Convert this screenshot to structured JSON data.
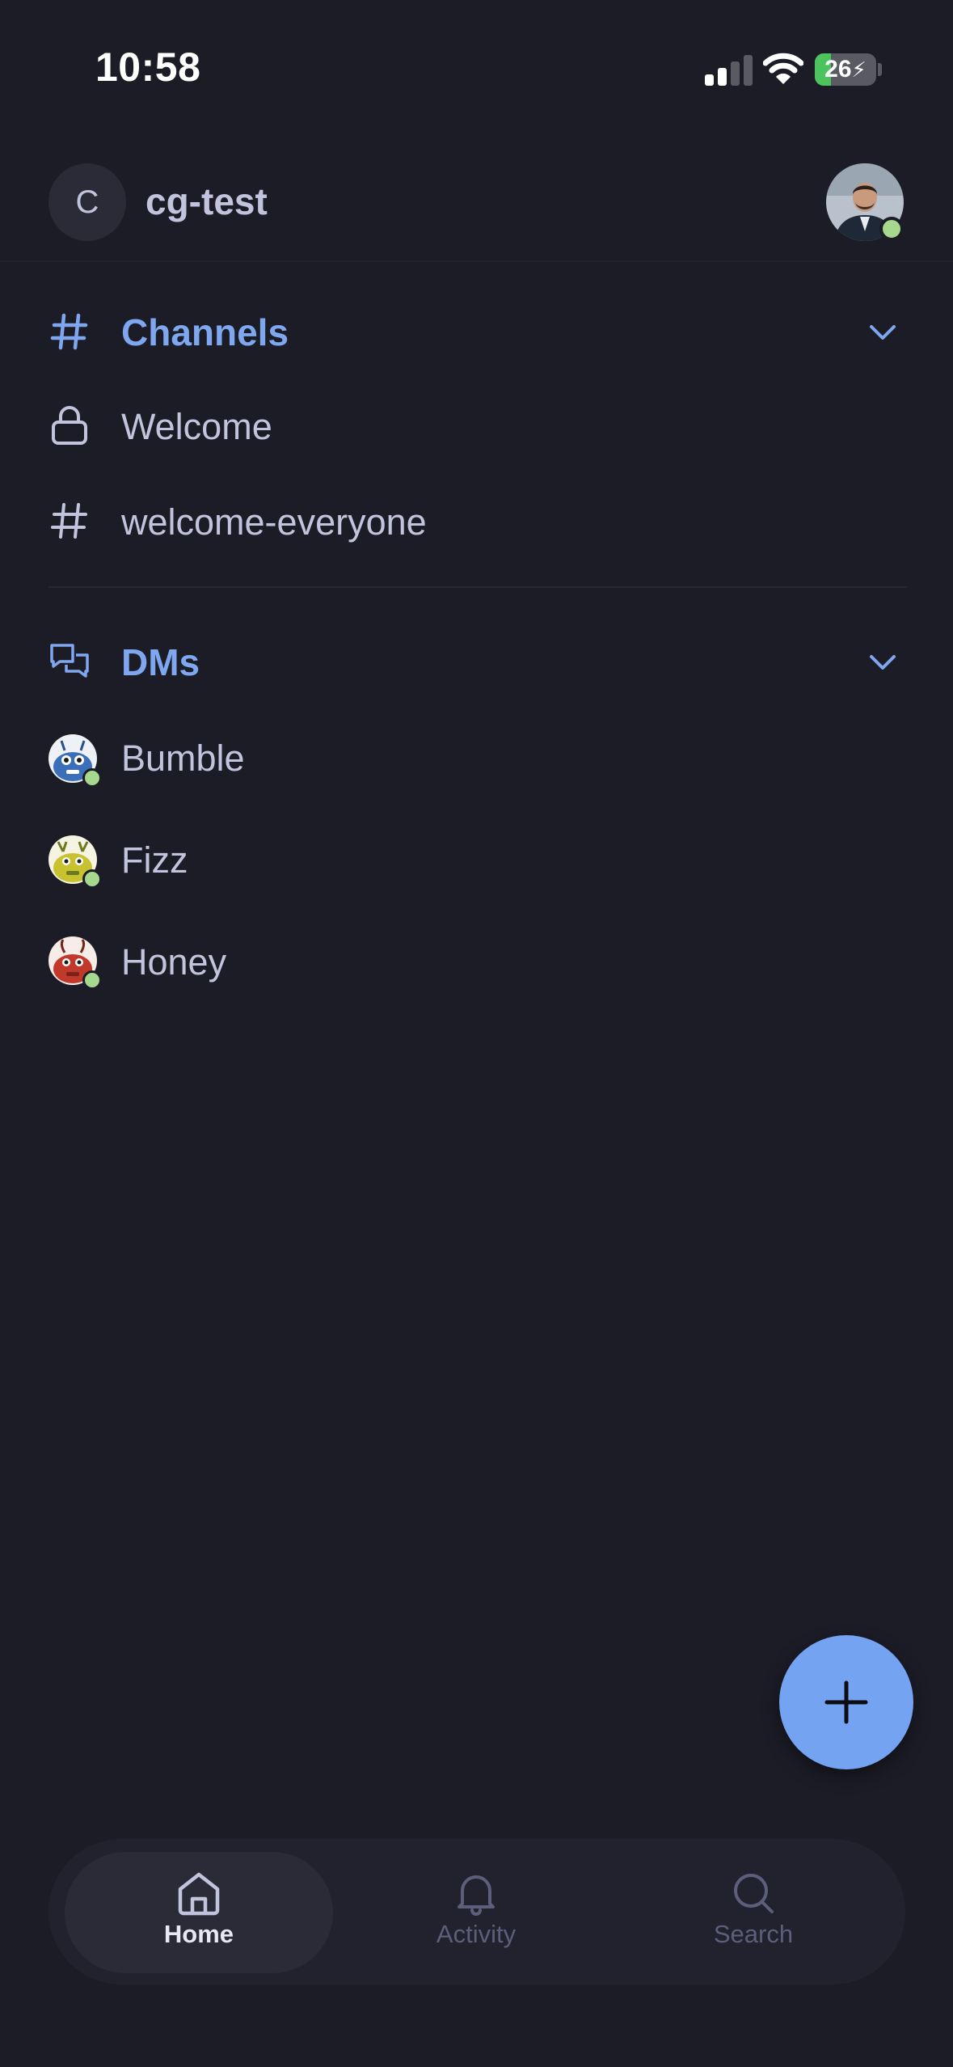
{
  "status_bar": {
    "time": "10:58",
    "battery": "26",
    "battery_level": 0.26
  },
  "workspace": {
    "initial": "C",
    "name": "cg-test"
  },
  "channels": {
    "title": "Channels",
    "items": [
      {
        "label": "Welcome",
        "icon": "lock-icon"
      },
      {
        "label": "welcome-everyone",
        "icon": "hash-icon"
      }
    ]
  },
  "dms": {
    "title": "DMs",
    "items": [
      {
        "label": "Bumble",
        "avatar_color": "#3b6fb8"
      },
      {
        "label": "Fizz",
        "avatar_color": "#c9c230"
      },
      {
        "label": "Honey",
        "avatar_color": "#c0392b"
      }
    ]
  },
  "nav": {
    "items": [
      {
        "label": "Home",
        "icon": "home-icon",
        "active": true
      },
      {
        "label": "Activity",
        "icon": "bell-icon",
        "active": false
      },
      {
        "label": "Search",
        "icon": "search-icon",
        "active": false
      }
    ]
  },
  "colors": {
    "accent": "#7ea7ef",
    "fab": "#74a3f2",
    "online": "#a6d88e",
    "background": "#1c1c27"
  }
}
